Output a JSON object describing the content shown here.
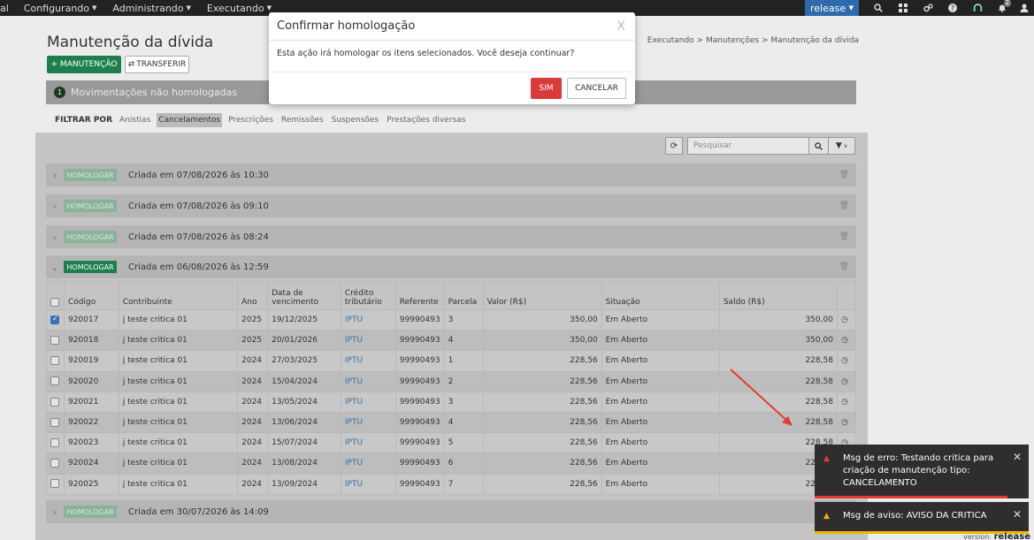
{
  "nav": {
    "items": [
      {
        "label": "al",
        "caret": false
      },
      {
        "label": "Configurando",
        "caret": true
      },
      {
        "label": "Administrando",
        "caret": true
      },
      {
        "label": "Executando",
        "caret": true
      }
    ],
    "release_label": "release",
    "notification_count": "2"
  },
  "page": {
    "title": "Manutenção da dívida",
    "breadcrumb": "Executando  >  Manutenções  >  Manutenção da dívida",
    "add_button": "+ MANUTENÇÃO",
    "transfer_button": "TRANSFERIR",
    "info_text": "Movimentações não homologadas",
    "info_count": "1"
  },
  "filter": {
    "label": "FILTRAR POR",
    "items": [
      "Anistias",
      "Cancelamentos",
      "Prescrições",
      "Remissões",
      "Suspensões",
      "Prestações diversas"
    ],
    "active": "Cancelamentos"
  },
  "search": {
    "placeholder": "Pesquisar"
  },
  "groups": [
    {
      "action": "HOMOLOGAR",
      "title": "Criada em 07/08/2026 às 10:30"
    },
    {
      "action": "HOMOLOGAR",
      "title": "Criada em 07/08/2026 às 09:10"
    },
    {
      "action": "HOMOLOGAR",
      "title": "Criada em 07/08/2026 às 08:24"
    },
    {
      "action": "HOMOLOGAR",
      "title": "Criada em 06/08/2026 às 12:59"
    },
    {
      "action": "HOMOLOGAR",
      "title": "Criada em 30/07/2026 às 14:09"
    }
  ],
  "table": {
    "headers": [
      "Código",
      "Contribuinte",
      "Ano",
      "Data de vencimento",
      "Crédito tributário",
      "Referente",
      "Parcela",
      "Valor (R$)",
      "Situação",
      "Saldo (R$)"
    ],
    "rows": [
      {
        "checked": true,
        "codigo": "920017",
        "contribuinte": "j teste critica 01",
        "ano": "2025",
        "vencimento": "19/12/2025",
        "credito": "IPTU",
        "referente": "99990493",
        "parcela": "3",
        "valor": "350,00",
        "situacao": "Em Aberto",
        "saldo": "350,00"
      },
      {
        "checked": false,
        "codigo": "920018",
        "contribuinte": "j teste critica 01",
        "ano": "2025",
        "vencimento": "20/01/2026",
        "credito": "IPTU",
        "referente": "99990493",
        "parcela": "4",
        "valor": "350,00",
        "situacao": "Em Aberto",
        "saldo": "350,00"
      },
      {
        "checked": false,
        "codigo": "920019",
        "contribuinte": "j teste critica 01",
        "ano": "2024",
        "vencimento": "27/03/2025",
        "credito": "IPTU",
        "referente": "99990493",
        "parcela": "1",
        "valor": "228,56",
        "situacao": "Em Aberto",
        "saldo": "228,58"
      },
      {
        "checked": false,
        "codigo": "920020",
        "contribuinte": "j teste critica 01",
        "ano": "2024",
        "vencimento": "15/04/2024",
        "credito": "IPTU",
        "referente": "99990493",
        "parcela": "2",
        "valor": "228,56",
        "situacao": "Em Aberto",
        "saldo": "228,58"
      },
      {
        "checked": false,
        "codigo": "920021",
        "contribuinte": "j teste critica 01",
        "ano": "2024",
        "vencimento": "13/05/2024",
        "credito": "IPTU",
        "referente": "99990493",
        "parcela": "3",
        "valor": "228,56",
        "situacao": "Em Aberto",
        "saldo": "228,58"
      },
      {
        "checked": false,
        "codigo": "920022",
        "contribuinte": "j teste critica 01",
        "ano": "2024",
        "vencimento": "13/06/2024",
        "credito": "IPTU",
        "referente": "99990493",
        "parcela": "4",
        "valor": "228,56",
        "situacao": "Em Aberto",
        "saldo": "228,58"
      },
      {
        "checked": false,
        "codigo": "920023",
        "contribuinte": "j teste critica 01",
        "ano": "2024",
        "vencimento": "15/07/2024",
        "credito": "IPTU",
        "referente": "99990493",
        "parcela": "5",
        "valor": "228,56",
        "situacao": "Em Aberto",
        "saldo": "228,58"
      },
      {
        "checked": false,
        "codigo": "920024",
        "contribuinte": "j teste critica 01",
        "ano": "2024",
        "vencimento": "13/08/2024",
        "credito": "IPTU",
        "referente": "99990493",
        "parcela": "6",
        "valor": "228,56",
        "situacao": "Em Aberto",
        "saldo": "228,58"
      },
      {
        "checked": false,
        "codigo": "920025",
        "contribuinte": "j teste critica 01",
        "ano": "2024",
        "vencimento": "13/09/2024",
        "credito": "IPTU",
        "referente": "99990493",
        "parcela": "7",
        "valor": "228,56",
        "situacao": "Em Aberto",
        "saldo": "228,58"
      }
    ]
  },
  "modal": {
    "title": "Confirmar homologação",
    "close": "X",
    "body": "Esta ação irá homologar os itens selecionados. Você deseja continuar?",
    "confirm": "SIM",
    "cancel": "CANCELAR"
  },
  "toasts": {
    "error": "Msg de erro: Testando critica para criação de manutenção tipo: CANCELAMENTO",
    "warning": "Msg de aviso: AVISO DA CRITICA"
  },
  "version": {
    "label": "version:",
    "value": "release"
  },
  "colors": {
    "primary_green": "#1e7f4c",
    "danger_red": "#d93b3b",
    "release_blue": "#2f6aad",
    "warning_yellow": "#f4b400",
    "arrow_red": "#e53935"
  }
}
